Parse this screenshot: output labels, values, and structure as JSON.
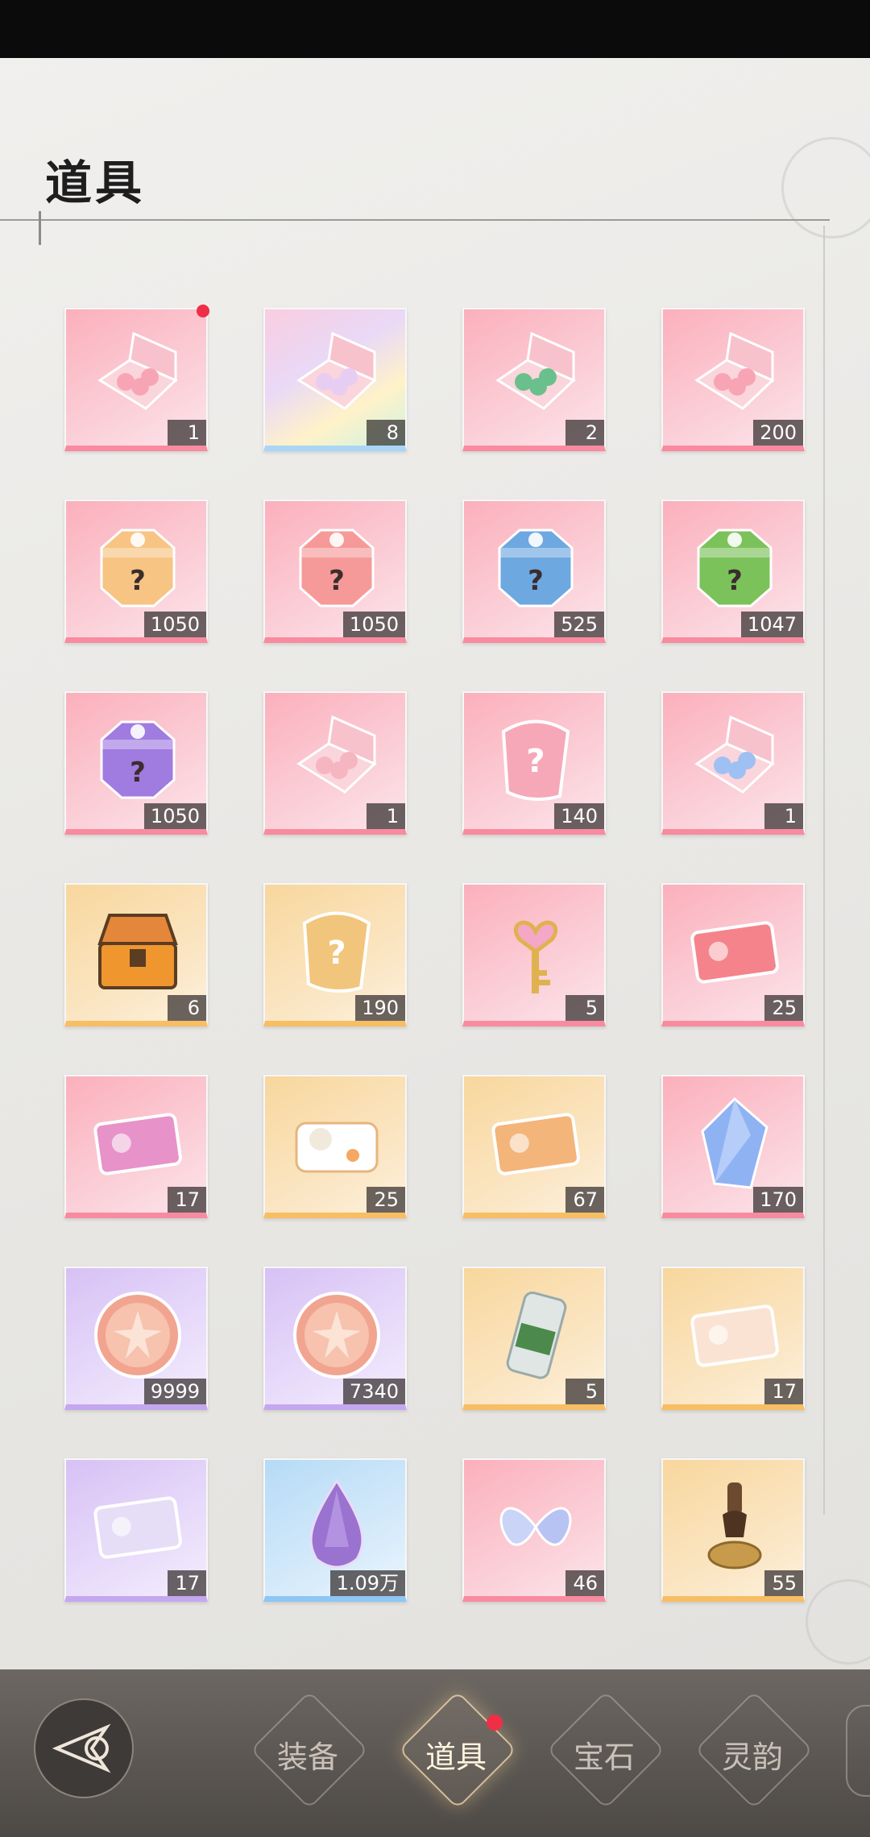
{
  "header": {
    "title": "道具"
  },
  "items": [
    {
      "qty": "1",
      "icon": "gift-box-icon",
      "theme": "pink",
      "has_dot": true
    },
    {
      "qty": "8",
      "icon": "holo-gift-box-icon",
      "theme": "rainbow"
    },
    {
      "qty": "2",
      "icon": "gem-gift-box-icon",
      "theme": "pink"
    },
    {
      "qty": "200",
      "icon": "gift-box-icon",
      "theme": "pink"
    },
    {
      "qty": "1050",
      "icon": "mystery-chest-orange-icon",
      "theme": "pink"
    },
    {
      "qty": "1050",
      "icon": "mystery-chest-red-icon",
      "theme": "pink"
    },
    {
      "qty": "525",
      "icon": "mystery-chest-blue-icon",
      "theme": "pink"
    },
    {
      "qty": "1047",
      "icon": "mystery-chest-green-icon",
      "theme": "pink"
    },
    {
      "qty": "1050",
      "icon": "mystery-chest-purple-icon",
      "theme": "pink"
    },
    {
      "qty": "1",
      "icon": "card-gift-box-icon",
      "theme": "pink"
    },
    {
      "qty": "140",
      "icon": "mystery-fragment-pink-icon",
      "theme": "pink"
    },
    {
      "qty": "1",
      "icon": "crystal-gift-box-icon",
      "theme": "pink"
    },
    {
      "qty": "6",
      "icon": "treasure-chest-icon",
      "theme": "gold"
    },
    {
      "qty": "190",
      "icon": "mystery-fragment-gold-icon",
      "theme": "gold"
    },
    {
      "qty": "5",
      "icon": "heart-key-icon",
      "theme": "pink"
    },
    {
      "qty": "25",
      "icon": "fashion-ticket-icon",
      "theme": "pink"
    },
    {
      "qty": "17",
      "icon": "portrait-card-pink-icon",
      "theme": "pink"
    },
    {
      "qty": "25",
      "icon": "cat-card-icon",
      "theme": "gold"
    },
    {
      "qty": "67",
      "icon": "portrait-card-gold-icon",
      "theme": "gold"
    },
    {
      "qty": "170",
      "icon": "blue-crystal-icon",
      "theme": "pink"
    },
    {
      "qty": "9999",
      "icon": "flower-coin-icon",
      "theme": "purple"
    },
    {
      "qty": "7340",
      "icon": "flower-coin-icon",
      "theme": "purple"
    },
    {
      "qty": "5",
      "icon": "drink-can-icon",
      "theme": "gold"
    },
    {
      "qty": "17",
      "icon": "letter-card-icon",
      "theme": "gold"
    },
    {
      "qty": "17",
      "icon": "photo-card-icon",
      "theme": "purple"
    },
    {
      "qty": "1.09万",
      "icon": "purple-teardrop-gem-icon",
      "theme": "blue"
    },
    {
      "qty": "46",
      "icon": "crystal-butterfly-icon",
      "theme": "pink"
    },
    {
      "qty": "55",
      "icon": "wax-seal-stamp-icon",
      "theme": "gold"
    }
  ],
  "bottom_nav": {
    "tabs": [
      {
        "label": "装备",
        "active": false
      },
      {
        "label": "道具",
        "active": true
      },
      {
        "label": "宝石",
        "active": false
      },
      {
        "label": "灵韵",
        "active": false
      }
    ]
  },
  "colors": {
    "badge_red": "#ef2f46",
    "pink_base": "#f98b9f",
    "gold_base": "#f7be64",
    "purple_base": "#c5a7ef",
    "blue_base": "#8ec6f4"
  }
}
